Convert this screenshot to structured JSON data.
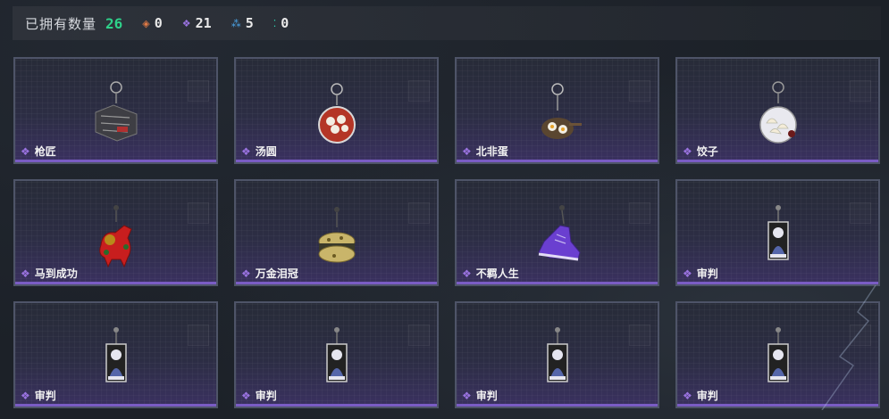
{
  "header": {
    "owned_label": "已拥有数量",
    "owned_count": "26",
    "rarities": [
      {
        "icon": "orange-diamond-icon",
        "color": "#e07a45",
        "count": "0"
      },
      {
        "icon": "purple-diamond-icon",
        "color": "#9a73e0",
        "count": "21"
      },
      {
        "icon": "blue-diamond-icon",
        "color": "#4aa3e6",
        "count": "5"
      },
      {
        "icon": "green-dots-icon",
        "color": "#2ed2b0",
        "count": "0"
      }
    ]
  },
  "items": [
    {
      "name": "枪匠",
      "icon": "gun-charm-icon",
      "rarity": "purple"
    },
    {
      "name": "汤圆",
      "icon": "tangyuan-charm-icon",
      "rarity": "purple"
    },
    {
      "name": "北非蛋",
      "icon": "shakshuka-charm-icon",
      "rarity": "purple"
    },
    {
      "name": "饺子",
      "icon": "dumpling-charm-icon",
      "rarity": "purple"
    },
    {
      "name": "马到成功",
      "icon": "horse-charm-icon",
      "rarity": "purple"
    },
    {
      "name": "万金泪冠",
      "icon": "gold-crown-charm-icon",
      "rarity": "purple"
    },
    {
      "name": "不羁人生",
      "icon": "sneaker-charm-icon",
      "rarity": "purple"
    },
    {
      "name": "审判",
      "icon": "judgment-card-charm-icon",
      "rarity": "purple"
    },
    {
      "name": "审判",
      "icon": "judgment-card-charm-icon",
      "rarity": "purple"
    },
    {
      "name": "审判",
      "icon": "judgment-card-charm-icon",
      "rarity": "purple"
    },
    {
      "name": "审判",
      "icon": "judgment-card-charm-icon",
      "rarity": "purple"
    },
    {
      "name": "审判",
      "icon": "judgment-card-charm-icon",
      "rarity": "purple"
    }
  ],
  "colors": {
    "accent_green": "#2ed28a",
    "card_border": "#4e5468",
    "rarity_purple": "#9a73e0"
  }
}
